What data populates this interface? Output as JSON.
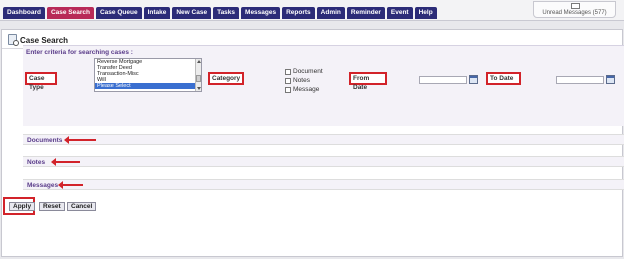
{
  "tabs": [
    {
      "label": "Dashboard",
      "active": false
    },
    {
      "label": "Case Search",
      "active": true
    },
    {
      "label": "Case Queue",
      "active": false
    },
    {
      "label": "Intake",
      "active": false
    },
    {
      "label": "New Case",
      "active": false
    },
    {
      "label": "Tasks",
      "active": false
    },
    {
      "label": "Messages",
      "active": false
    },
    {
      "label": "Reports",
      "active": false
    },
    {
      "label": "Admin",
      "active": false
    },
    {
      "label": "Reminder",
      "active": false
    },
    {
      "label": "Event",
      "active": false
    },
    {
      "label": "Help",
      "active": false
    }
  ],
  "unread": {
    "label": "Unread Messages (577)"
  },
  "page": {
    "title": "Case Search"
  },
  "criteria": {
    "title": "Enter criteria for searching cases :",
    "case_type_label": "Case Type",
    "case_type_options": [
      "Reverse Mortgage",
      "Transfer Deed",
      "Transaction-Misc",
      "Will",
      "Please Select"
    ],
    "case_type_selected": "Please Select",
    "category_label": "Category",
    "checkboxes": [
      "Document",
      "Notes",
      "Message"
    ],
    "from_date_label": "From Date",
    "to_date_label": "To Date",
    "from_date_value": "",
    "to_date_value": ""
  },
  "sections": {
    "documents": "Documents",
    "notes": "Notes",
    "messages": "Messages"
  },
  "buttons": {
    "apply": "Apply",
    "reset": "Reset",
    "cancel": "Cancel"
  },
  "colors": {
    "tab": "#2c2c78",
    "tab_active": "#b82a57",
    "highlight": "#d2232a",
    "section_label": "#5a3c8a"
  }
}
